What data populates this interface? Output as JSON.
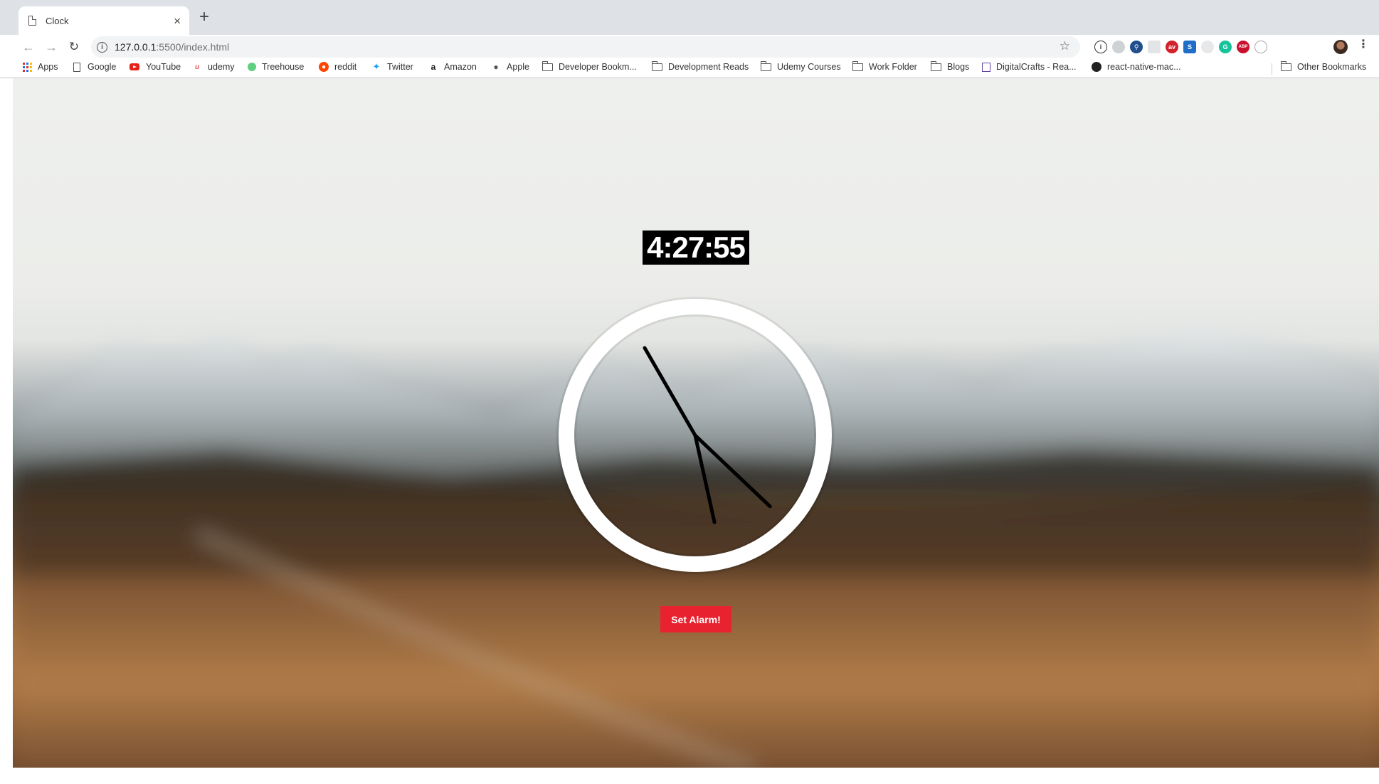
{
  "browser": {
    "tab_title": "Clock",
    "tab_close": "×",
    "new_tab": "+",
    "url_host": "127.0.0.1",
    "url_path": ":5500/index.html",
    "bookmarks": [
      {
        "label": "Apps",
        "icon": "apps-icon"
      },
      {
        "label": "Google",
        "icon": "page-icon"
      },
      {
        "label": "YouTube",
        "icon": "youtube-icon"
      },
      {
        "label": "udemy",
        "icon": "udemy-icon"
      },
      {
        "label": "Treehouse",
        "icon": "treehouse-icon"
      },
      {
        "label": "reddit",
        "icon": "reddit-icon"
      },
      {
        "label": "Twitter",
        "icon": "twitter-icon"
      },
      {
        "label": "Amazon",
        "icon": "amazon-icon"
      },
      {
        "label": "Apple",
        "icon": "apple-icon"
      },
      {
        "label": "Developer Bookm...",
        "icon": "folder-icon"
      },
      {
        "label": "Development Reads",
        "icon": "folder-icon"
      },
      {
        "label": "Udemy Courses",
        "icon": "folder-icon"
      },
      {
        "label": "Work Folder",
        "icon": "folder-icon"
      },
      {
        "label": "Blogs",
        "icon": "folder-icon"
      },
      {
        "label": "DigitalCrafts - Rea...",
        "icon": "twitch-icon"
      },
      {
        "label": "react-native-mac...",
        "icon": "github-icon"
      }
    ],
    "other_bookmarks": "Other Bookmarks",
    "extension_badges": [
      "ABP"
    ]
  },
  "page": {
    "digital_time": "4:27:55",
    "alarm_button": "Set Alarm!",
    "clock": {
      "hours": 4,
      "minutes": 27,
      "seconds": 55
    },
    "colors": {
      "alarm_button": "#e8222f",
      "clock_face": "#ffffff",
      "hands": "#000000",
      "digital_bg": "#000000"
    }
  }
}
